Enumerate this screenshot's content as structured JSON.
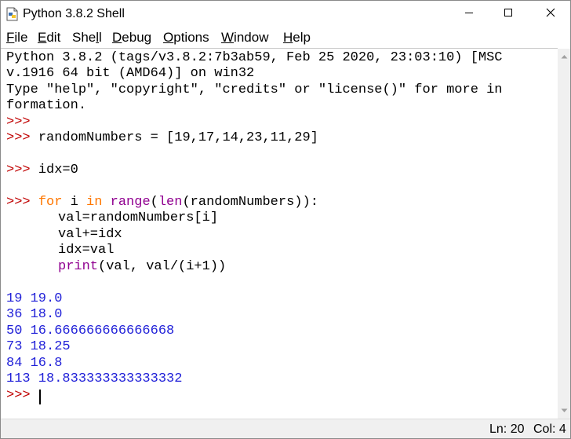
{
  "window": {
    "title": "Python 3.8.2 Shell"
  },
  "menu": {
    "file": {
      "acc": "F",
      "rest": "ile"
    },
    "edit": {
      "acc": "E",
      "rest": "dit"
    },
    "shell": {
      "pre": "She",
      "acc": "l",
      "rest": "l"
    },
    "debug": {
      "acc": "D",
      "rest": "ebug"
    },
    "options": {
      "acc": "O",
      "rest": "ptions"
    },
    "window": {
      "acc": "W",
      "rest": "indow"
    },
    "help": {
      "acc": "H",
      "rest": "elp"
    }
  },
  "shell": {
    "prompt": ">>>",
    "banner": [
      "Python 3.8.2 (tags/v3.8.2:7b3ab59, Feb 25 2020, 23:03:10) [MSC",
      "v.1916 64 bit (AMD64)] on win32",
      "Type \"help\", \"copyright\", \"credits\" or \"license()\" for more in",
      "formation."
    ],
    "cmd1": "randomNumbers = [19,17,14,23,11,29]",
    "cmd2": "idx=0",
    "for": {
      "kw_for": "for",
      "var": " i ",
      "kw_in": "in",
      "sp": " ",
      "range": "range",
      "p1": "(",
      "len": "len",
      "rest": "(randomNumbers)):"
    },
    "body": [
      "val=randomNumbers[i]",
      "val+=idx",
      "idx=val"
    ],
    "print": {
      "fn": "print",
      "args": "(val, val/(i+1))"
    },
    "output": [
      "19 19.0",
      "36 18.0",
      "50 16.666666666666668",
      "73 18.25",
      "84 16.8",
      "113 18.833333333333332"
    ]
  },
  "status": {
    "line": "Ln: 20",
    "col": "Col: 4"
  }
}
